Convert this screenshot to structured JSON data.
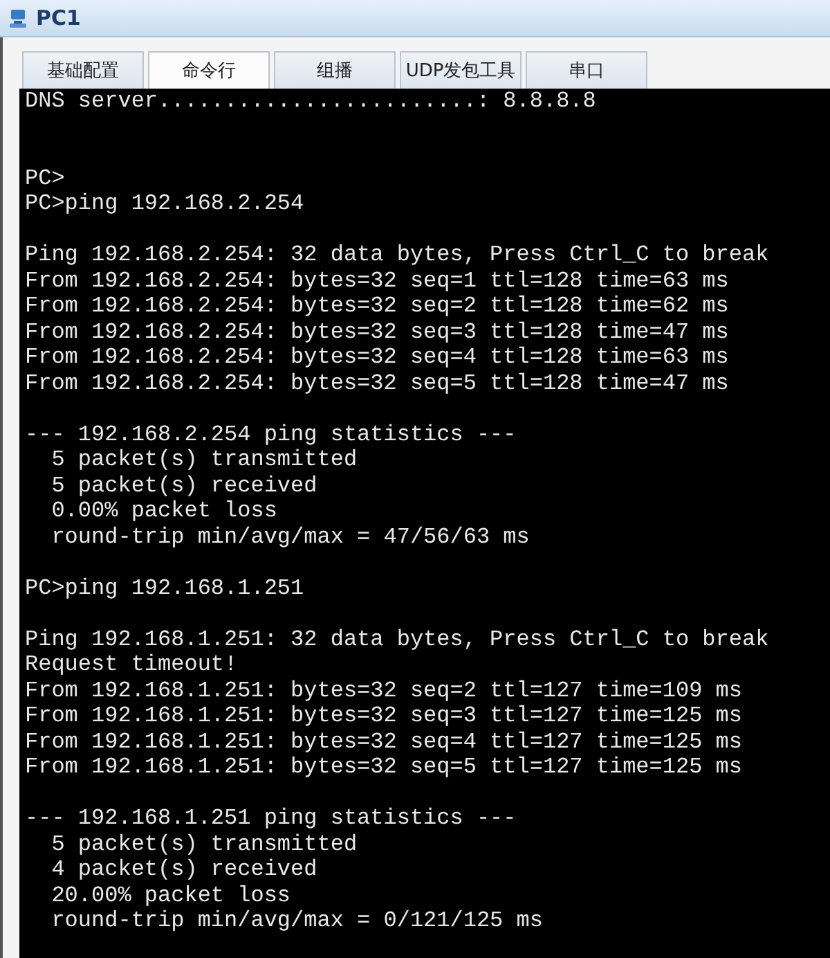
{
  "window": {
    "title": "PC1"
  },
  "tabs": [
    {
      "label": "基础配置",
      "selected": false
    },
    {
      "label": "命令行",
      "selected": true
    },
    {
      "label": "组播",
      "selected": false
    },
    {
      "label": "UDP发包工具",
      "selected": false
    },
    {
      "label": "串口",
      "selected": false
    }
  ],
  "terminal": {
    "lines": [
      {
        "kind": "text",
        "text": "DNS server........................: 8.8.8.8"
      },
      {
        "kind": "blank"
      },
      {
        "kind": "blank"
      },
      {
        "kind": "text",
        "text": "PC>"
      },
      {
        "kind": "text",
        "text": "PC>ping 192.168.2.254"
      },
      {
        "kind": "blank"
      },
      {
        "kind": "text",
        "text": "Ping 192.168.2.254: 32 data bytes, Press Ctrl_C to break"
      },
      {
        "kind": "text",
        "text": "From 192.168.2.254: bytes=32 seq=1 ttl=128 time=63 ms"
      },
      {
        "kind": "text",
        "text": "From 192.168.2.254: bytes=32 seq=2 ttl=128 time=62 ms"
      },
      {
        "kind": "text",
        "text": "From 192.168.2.254: bytes=32 seq=3 ttl=128 time=47 ms"
      },
      {
        "kind": "text",
        "text": "From 192.168.2.254: bytes=32 seq=4 ttl=128 time=63 ms"
      },
      {
        "kind": "text",
        "text": "From 192.168.2.254: bytes=32 seq=5 ttl=128 time=47 ms"
      },
      {
        "kind": "blank"
      },
      {
        "kind": "text",
        "text": "--- 192.168.2.254 ping statistics ---"
      },
      {
        "kind": "text",
        "text": "  5 packet(s) transmitted"
      },
      {
        "kind": "text",
        "text": "  5 packet(s) received"
      },
      {
        "kind": "text",
        "text": "  0.00% packet loss"
      },
      {
        "kind": "text",
        "text": "  round-trip min/avg/max = 47/56/63 ms"
      },
      {
        "kind": "blank"
      },
      {
        "kind": "text",
        "text": "PC>ping 192.168.1.251"
      },
      {
        "kind": "blank"
      },
      {
        "kind": "text",
        "text": "Ping 192.168.1.251: 32 data bytes, Press Ctrl_C to break"
      },
      {
        "kind": "text",
        "text": "Request timeout!"
      },
      {
        "kind": "text",
        "text": "From 192.168.1.251: bytes=32 seq=2 ttl=127 time=109 ms"
      },
      {
        "kind": "text",
        "text": "From 192.168.1.251: bytes=32 seq=3 ttl=127 time=125 ms"
      },
      {
        "kind": "text",
        "text": "From 192.168.1.251: bytes=32 seq=4 ttl=127 time=125 ms"
      },
      {
        "kind": "text",
        "text": "From 192.168.1.251: bytes=32 seq=5 ttl=127 time=125 ms"
      },
      {
        "kind": "blank"
      },
      {
        "kind": "text",
        "text": "--- 192.168.1.251 ping statistics ---"
      },
      {
        "kind": "text",
        "text": "  5 packet(s) transmitted"
      },
      {
        "kind": "text",
        "text": "  4 packet(s) received"
      },
      {
        "kind": "text",
        "text": "  20.00% packet loss"
      },
      {
        "kind": "text",
        "text": "  round-trip min/avg/max = 0/121/125 ms"
      }
    ]
  }
}
